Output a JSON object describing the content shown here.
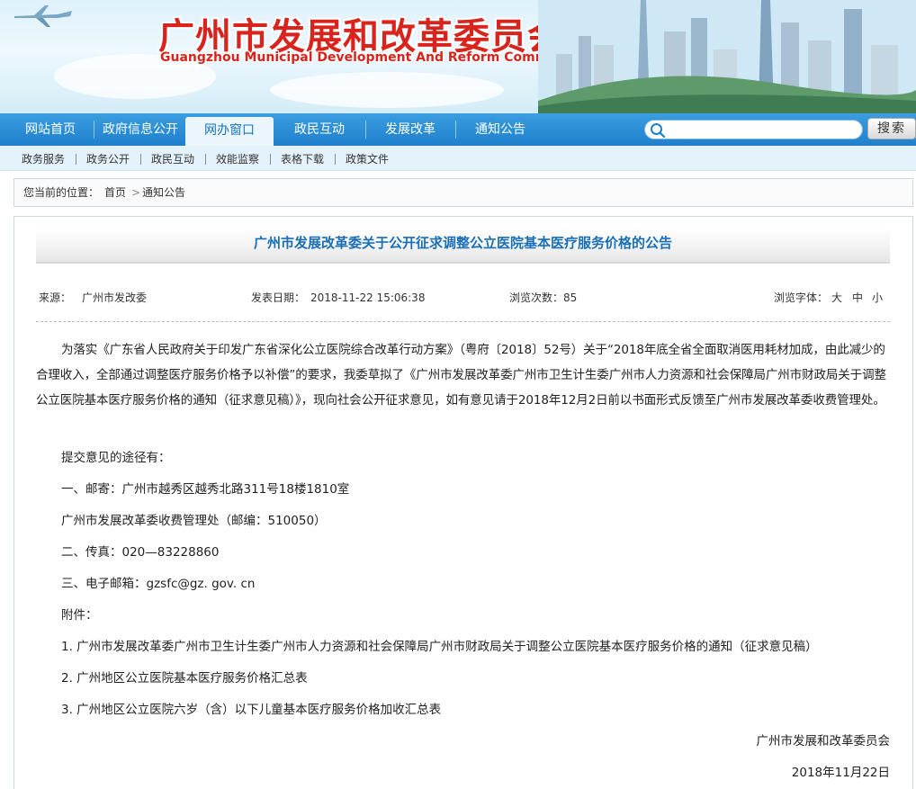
{
  "banner": {
    "title_cn": "广州市发展和改革委员会",
    "title_en": "Guangzhou Municipal Development And Reform Commission"
  },
  "main_nav": {
    "items": [
      {
        "label": "网站首页"
      },
      {
        "label": "政府信息公开"
      },
      {
        "label": "网办窗口"
      },
      {
        "label": "政民互动"
      },
      {
        "label": "发展改革"
      },
      {
        "label": "通知公告"
      }
    ],
    "active_index": 2,
    "search_placeholder": "",
    "search_button": "搜索"
  },
  "sub_nav": {
    "items": [
      {
        "label": "政务服务"
      },
      {
        "label": "政务公开"
      },
      {
        "label": "政民互动"
      },
      {
        "label": "效能监察"
      },
      {
        "label": "表格下载"
      },
      {
        "label": "政策文件"
      }
    ]
  },
  "breadcrumb": {
    "prefix": "您当前的位置：",
    "home": "首页",
    "separator": ">",
    "current": "通知公告"
  },
  "article": {
    "title": "广州市发展改革委关于公开征求调整公立医院基本医疗服务价格的公告",
    "meta": {
      "source_label": "来源：",
      "source_value": "广州市发改委",
      "date_label": "发表日期：",
      "date_value": "2018-11-22 15:06:38",
      "views_label": "浏览次数：",
      "views_value": "85",
      "font_label": "浏览字体：",
      "font_large": "大",
      "font_medium": "中",
      "font_small": "小"
    },
    "paragraph1": "为落实《广东省人民政府关于印发广东省深化公立医院综合改革行动方案》（粤府〔2018〕52号）关于“2018年底全省全面取消医用耗材加成，由此减少的合理收入，全部通过调整医疗服务价格予以补偿”的要求，我委草拟了《广州市发展改革委广州市卫生计生委广州市人力资源和社会保障局广州市财政局关于调整公立医院基本医疗服务价格的通知（征求意见稿）》，现向社会公开征求意见，如有意见请于2018年12月2日前以书面形式反馈至广州市发展改革委收费管理处。",
    "ways_title": "提交意见的途径有：",
    "way_mail": "一、邮寄：广州市越秀区越秀北路311号18楼1810室",
    "way_mail_dept": "广州市发展改革委收费管理处（邮编：510050）",
    "way_fax": "二、传真：020—83228860",
    "way_email": "三、电子邮箱：gzsfc@gz. gov. cn",
    "attachments_label": "附件：",
    "attachments": [
      "1. 广州市发展改革委广州市卫生计生委广州市人力资源和社会保障局广州市财政局关于调整公立医院基本医疗服务价格的通知（征求意见稿）",
      "2. 广州地区公立医院基本医疗服务价格汇总表",
      "3. 广州地区公立医院六岁（含）以下儿童基本医疗服务价格加收汇总表"
    ],
    "signature": "广州市发展和改革委员会",
    "sign_date": "2018年11月22日"
  },
  "colors": {
    "nav_blue": "#1f7fcc",
    "title_red": "#d9231d",
    "article_title_blue": "#1a6fb5"
  }
}
